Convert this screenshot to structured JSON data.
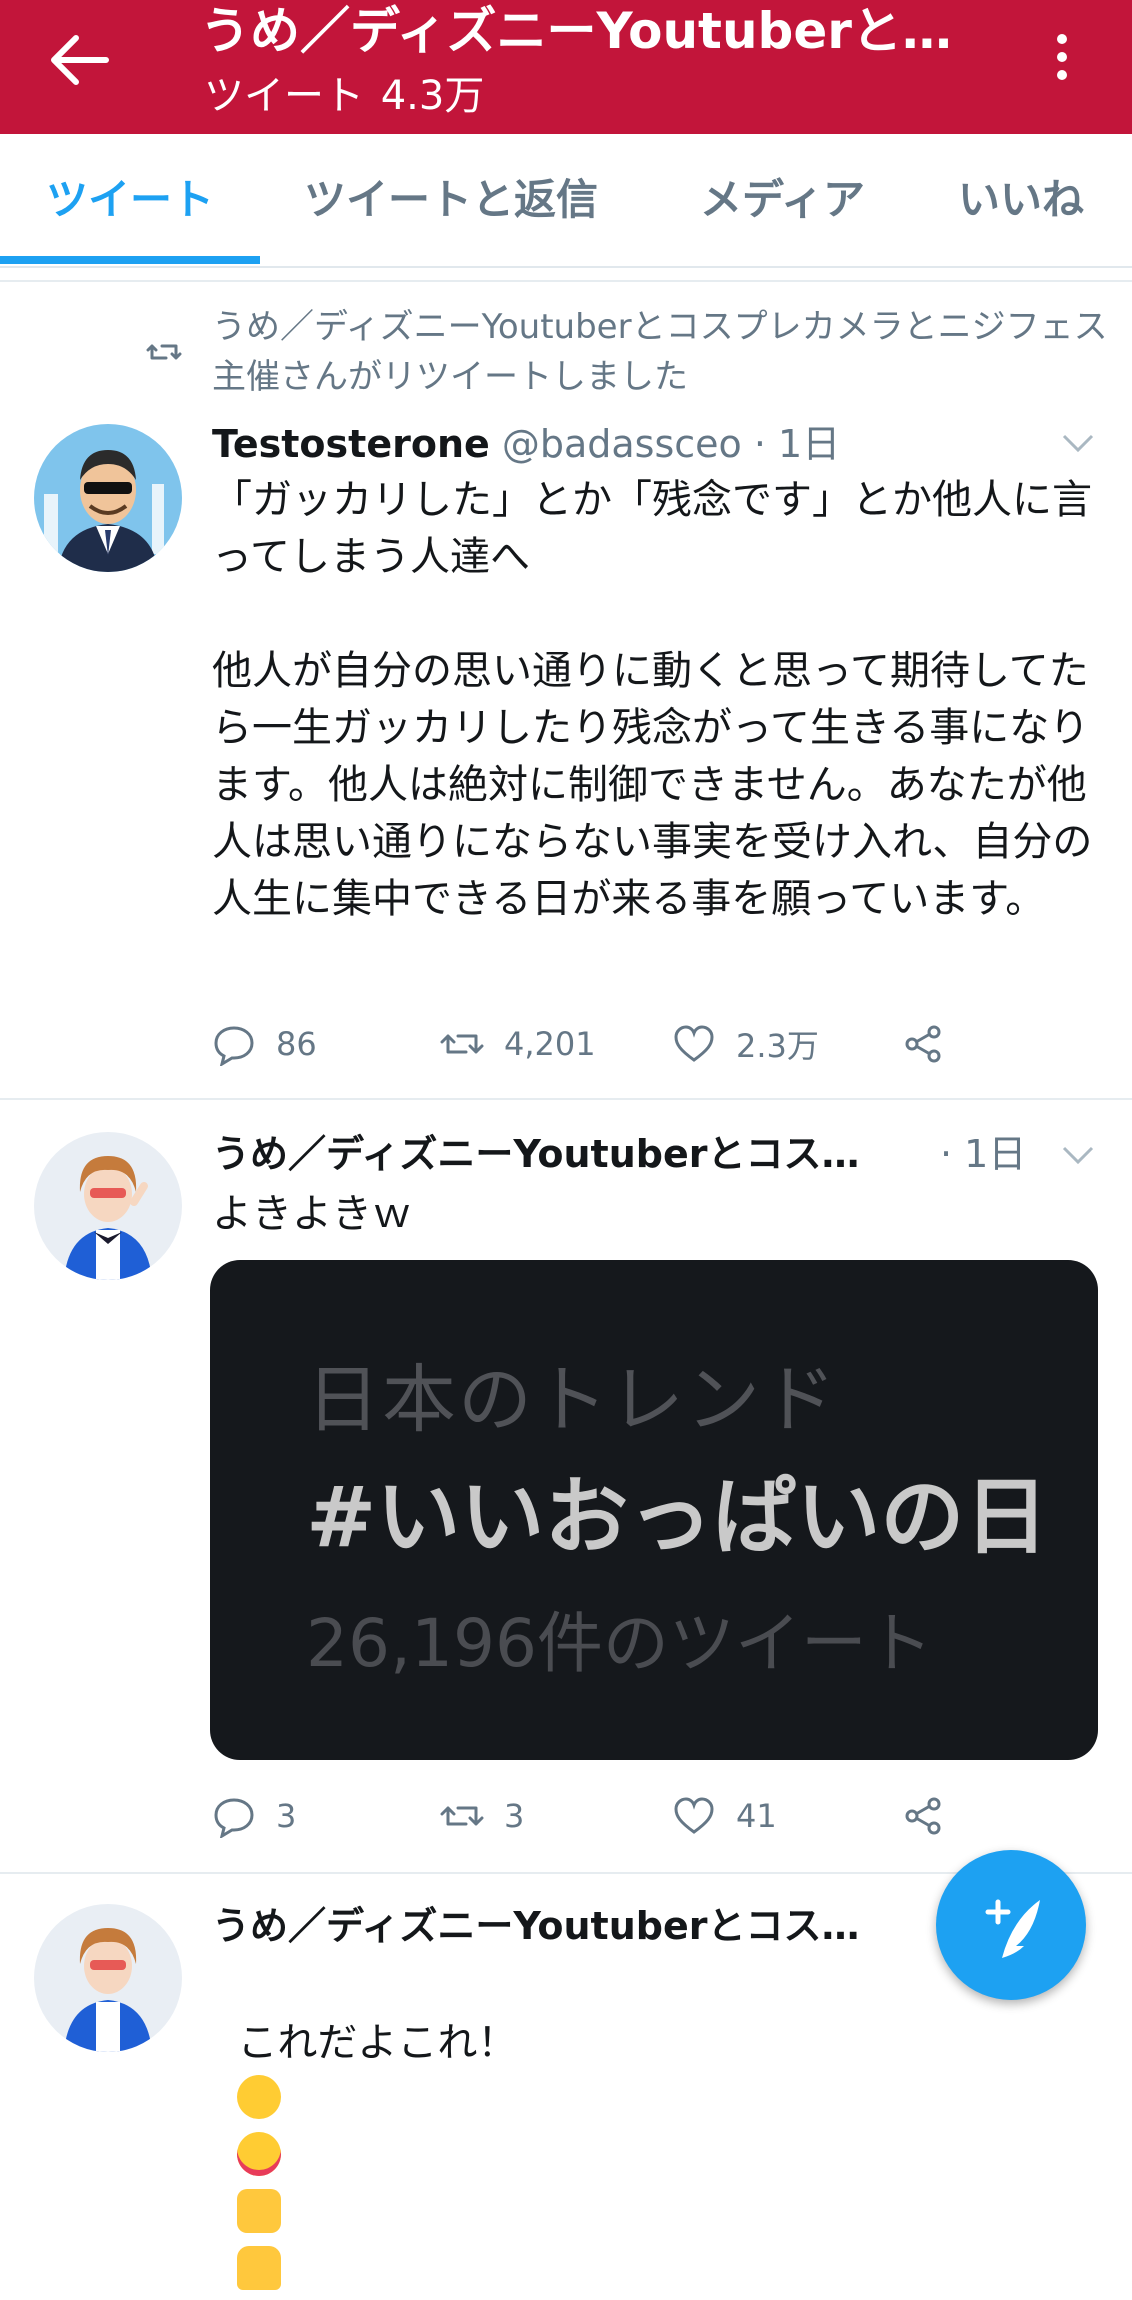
{
  "header": {
    "title": "うめ／ディズニーYoutuberと…",
    "tweets_label": "ツイート",
    "tweets_count": "4.3万"
  },
  "tabs": [
    {
      "label": "ツイート",
      "active": true
    },
    {
      "label": "ツイートと返信",
      "active": false
    },
    {
      "label": "メディア",
      "active": false
    },
    {
      "label": "いいね",
      "active": false
    }
  ],
  "tweets": [
    {
      "retweet_notice": "うめ／ディズニーYoutuberとコスプレカメラとニジフェス主催さんがリツイートしました",
      "name": "Testosterone",
      "handle": "@badassceo · 1日",
      "text": "「ガッカリした」とか「残念です」とか他人に言ってしまう人達へ\n\n他人が自分の思い通りに動くと思って期待してたら一生ガッカリしたり残念がって生きる事になります。他人は絶対に制御できません。あなたが他人は思い通りにならない事実を受け入れ、自分の人生に集中できる日が来る事を願っています。",
      "replies": "86",
      "retweets": "4,201",
      "likes": "2.3万"
    },
    {
      "name": "うめ／ディズニーYoutuberとコス…",
      "time": "· 1日",
      "text": "よきよきｗ",
      "media": {
        "line1": "日本のトレンド",
        "line2": "#いいおっぱいの日",
        "line3": "26,196件のツイート"
      },
      "replies": "3",
      "retweets": "3",
      "likes": "41"
    },
    {
      "name": "うめ／ディズニーYoutuberとコス…",
      "text": "これだよこれ！",
      "emojis": [
        "grinning-squinting-face",
        "heart-eyes-face",
        "thumbs-up",
        "victory-hand"
      ]
    }
  ],
  "colors": {
    "header_bg": "#c2153a",
    "accent": "#1da1f2",
    "muted": "#657786"
  }
}
